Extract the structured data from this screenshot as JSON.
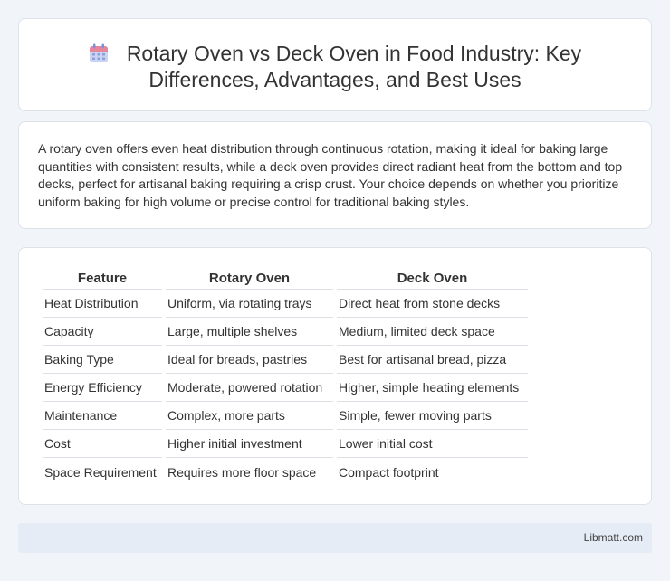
{
  "header": {
    "title": "Rotary Oven vs Deck Oven in Food Industry: Key Differences, Advantages, and Best Uses",
    "icon": "calendar-icon"
  },
  "intro": {
    "text": "A rotary oven offers even heat distribution through continuous rotation, making it ideal for baking large quantities with consistent results, while a deck oven provides direct radiant heat from the bottom and top decks, perfect for artisanal baking requiring a crisp crust. Your choice depends on whether you prioritize uniform baking for high volume or precise control for traditional baking styles."
  },
  "table": {
    "headers": [
      "Feature",
      "Rotary Oven",
      "Deck Oven"
    ],
    "rows": [
      [
        "Heat Distribution",
        "Uniform, via rotating trays",
        "Direct heat from stone decks"
      ],
      [
        "Capacity",
        "Large, multiple shelves",
        "Medium, limited deck space"
      ],
      [
        "Baking Type",
        "Ideal for breads, pastries",
        "Best for artisanal bread, pizza"
      ],
      [
        "Energy Efficiency",
        "Moderate, powered rotation",
        "Higher, simple heating elements"
      ],
      [
        "Maintenance",
        "Complex, more parts",
        "Simple, fewer moving parts"
      ],
      [
        "Cost",
        "Higher initial investment",
        "Lower initial cost"
      ],
      [
        "Space Requirement",
        "Requires more floor space",
        "Compact footprint"
      ]
    ]
  },
  "footer": {
    "text": "Libmatt.com"
  }
}
